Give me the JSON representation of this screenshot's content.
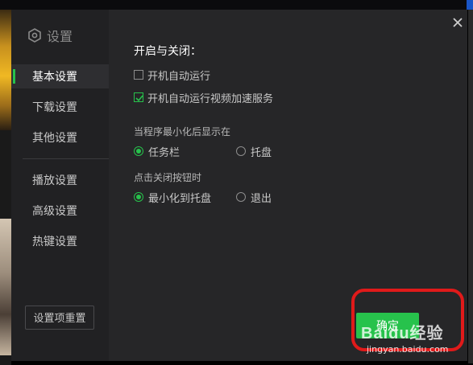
{
  "sidebar": {
    "title": "设置",
    "items": [
      {
        "label": "基本设置"
      },
      {
        "label": "下载设置"
      },
      {
        "label": "其他设置"
      },
      {
        "label": "播放设置"
      },
      {
        "label": "高级设置"
      },
      {
        "label": "热键设置"
      }
    ],
    "reset_label": "设置项重置"
  },
  "content": {
    "section_title": "开启与关闭：",
    "options": [
      {
        "label": "开机自动运行",
        "checked": false
      },
      {
        "label": "开机自动运行视频加速服务",
        "checked": true
      }
    ],
    "minimize_group": {
      "label": "当程序最小化后显示在",
      "choices": [
        "任务栏",
        "托盘"
      ],
      "selected": "任务栏"
    },
    "close_group": {
      "label": "点击关闭按钮时",
      "choices": [
        "最小化到托盘",
        "退出"
      ],
      "selected": "最小化到托盘"
    }
  },
  "footer": {
    "confirm_label": "确定"
  },
  "watermark": {
    "text": "Baidu经验",
    "url": "jingyan.baidu.com"
  },
  "colors": {
    "accent": "#27c24c",
    "dialog_bg": "#262628",
    "sidebar_bg": "#212123",
    "highlight": "#e01a1a"
  }
}
